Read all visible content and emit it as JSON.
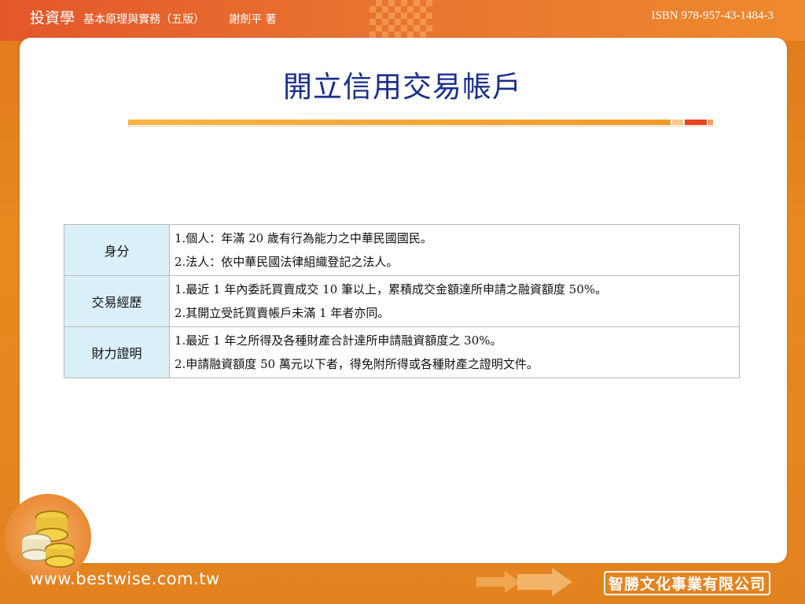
{
  "header": {
    "book_title": "投資學",
    "subtitle": "基本原理與實務（五版）",
    "author": "謝劍平 著",
    "isbn": "ISBN 978-957-43-1484-3"
  },
  "slide": {
    "title": "開立信用交易帳戶"
  },
  "table": {
    "rows": [
      {
        "label": "身分",
        "lines": [
          "1.個人：年滿 20 歲有行為能力之中華民國國民。",
          "2.法人：依中華民國法律組織登記之法人。"
        ]
      },
      {
        "label": "交易經歷",
        "lines": [
          "1.最近 1 年內委託買賣成交 10 筆以上，累積成交金額達所申請之融資額度 50%。",
          "2.其開立受託買賣帳戶未滿 1 年者亦同。"
        ]
      },
      {
        "label": "財力證明",
        "lines": [
          "1.最近 1 年之所得及各種財產合計達所申請融資額度之 30%。",
          "2.申請融資額度 50 萬元以下者，得免附所得或各種財產之證明文件。"
        ]
      }
    ]
  },
  "footer": {
    "url": "www.bestwise.com.tw",
    "company": "智勝文化事業有限公司",
    "icons": [
      "coins-icon",
      "arrow-icon"
    ]
  },
  "colors": {
    "title": "#1a2e8a",
    "label_bg": "#d9f0f9",
    "frame_orange": "#e8891f"
  }
}
